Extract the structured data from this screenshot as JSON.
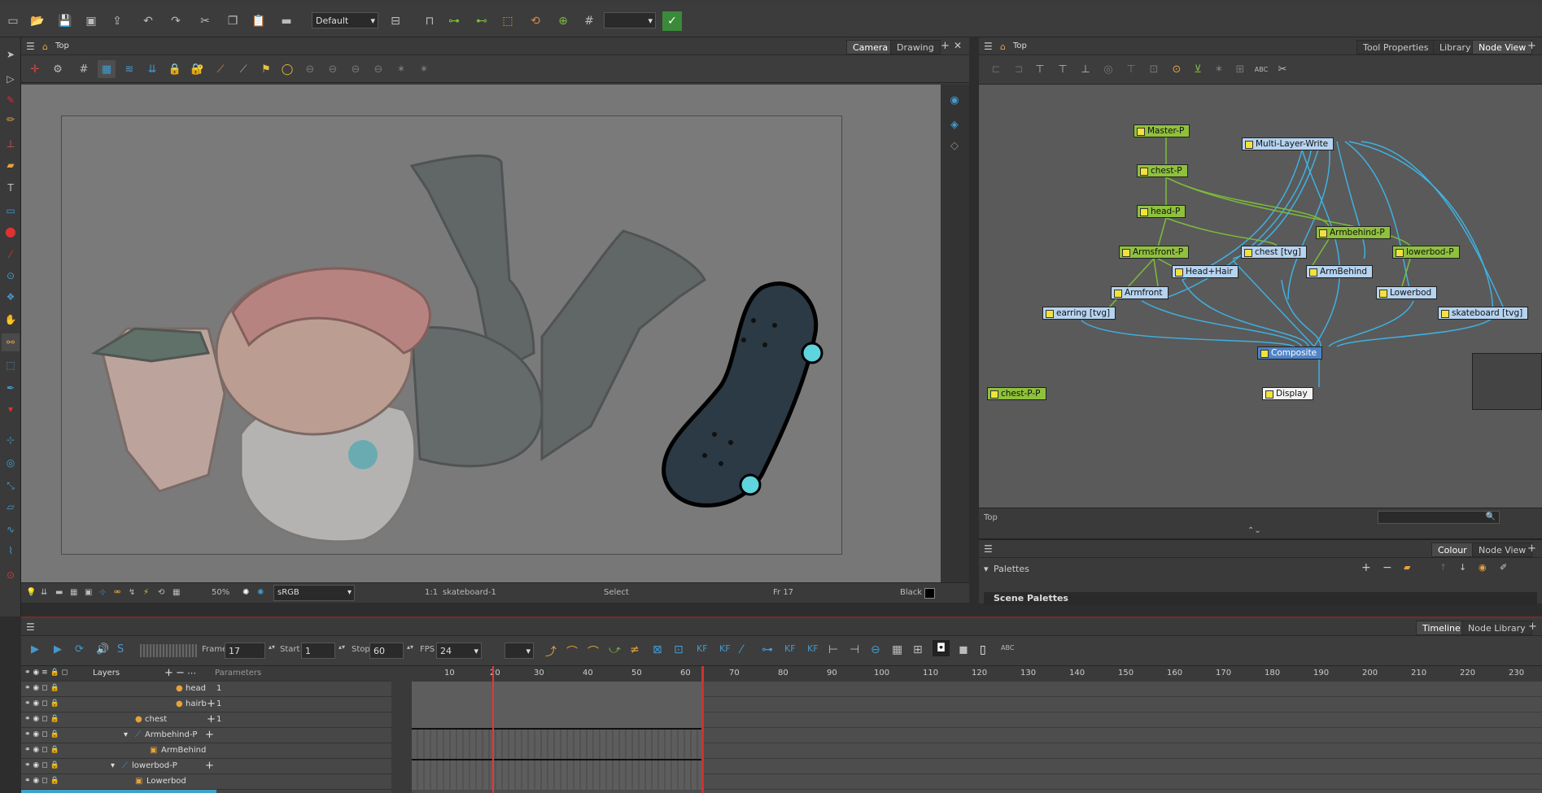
{
  "toolbar": {
    "workspace": "Default"
  },
  "camera_view": {
    "breadcrumb": "Top",
    "tabs": [
      {
        "label": "Camera"
      },
      {
        "label": "Drawing"
      }
    ],
    "zoom": "50%",
    "colorspace": "sRGB",
    "ratio": "1:1",
    "layer": "skateboard-1",
    "tool": "Select",
    "frame": "Fr 17",
    "colour": "Black"
  },
  "node_view": {
    "breadcrumb": "Top",
    "tabs": [
      {
        "label": "Tool Properties"
      },
      {
        "label": "Library"
      },
      {
        "label": "Node View"
      }
    ],
    "status": "Top",
    "nodes": [
      {
        "label": "Master-P",
        "kind": "peg"
      },
      {
        "label": "Multi-Layer-Write",
        "kind": "comp"
      },
      {
        "label": "chest-P",
        "kind": "peg"
      },
      {
        "label": "head-P",
        "kind": "peg"
      },
      {
        "label": "Armbehind-P",
        "kind": "peg"
      },
      {
        "label": "Armsfront-P",
        "kind": "peg"
      },
      {
        "label": "chest [tvg]",
        "kind": "el"
      },
      {
        "label": "lowerbod-P",
        "kind": "peg"
      },
      {
        "label": "Head+Hair",
        "kind": "el"
      },
      {
        "label": "ArmBehind",
        "kind": "el"
      },
      {
        "label": "Armfront",
        "kind": "el"
      },
      {
        "label": "Lowerbod",
        "kind": "el"
      },
      {
        "label": "earring [tvg]",
        "kind": "el"
      },
      {
        "label": "skateboard [tvg]",
        "kind": "el"
      },
      {
        "label": "Composite",
        "kind": "comp"
      },
      {
        "label": "chest-P-P",
        "kind": "peg"
      },
      {
        "label": "Display",
        "kind": "disp"
      }
    ]
  },
  "colour_panel": {
    "tabs": [
      {
        "label": "Colour"
      },
      {
        "label": "Node View"
      }
    ],
    "palettes_label": "Palettes",
    "scene_palettes": "Scene Palettes"
  },
  "timeline": {
    "tabs": [
      {
        "label": "Timeline"
      },
      {
        "label": "Node Library"
      }
    ],
    "frame_label": "Frame",
    "frame": "17",
    "start_label": "Start",
    "start": "1",
    "stop_label": "Stop",
    "stop": "60",
    "fps_label": "FPS",
    "fps": "24",
    "layers_header": "Layers",
    "params_header": "Parameters",
    "ruler": [
      "10",
      "20",
      "30",
      "40",
      "50",
      "60",
      "70",
      "80",
      "90",
      "100",
      "110",
      "120",
      "130",
      "140",
      "150",
      "160",
      "170",
      "180",
      "190",
      "200",
      "210",
      "220",
      "230"
    ],
    "layers": [
      {
        "name": "head",
        "value": "1"
      },
      {
        "name": "hairb",
        "value": "1"
      },
      {
        "name": "chest",
        "value": "1"
      },
      {
        "name": "Armbehind-P",
        "value": ""
      },
      {
        "name": "ArmBehind",
        "value": ""
      },
      {
        "name": "lowerbod-P",
        "value": ""
      },
      {
        "name": "Lowerbod",
        "value": ""
      }
    ]
  }
}
